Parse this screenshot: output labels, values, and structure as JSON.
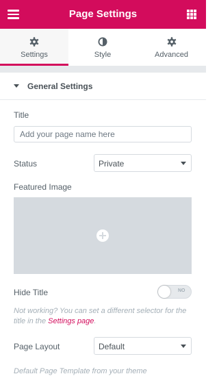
{
  "header": {
    "title": "Page Settings",
    "menu_icon": "hamburger-menu-icon",
    "apps_icon": "grid-apps-icon",
    "accent_color": "#d30c5c"
  },
  "tabs": [
    {
      "label": "Settings",
      "icon": "gear-icon",
      "active": true
    },
    {
      "label": "Style",
      "icon": "half-circle-contrast-icon",
      "active": false
    },
    {
      "label": "Advanced",
      "icon": "gear-icon",
      "active": false
    }
  ],
  "section": {
    "title": "General Settings",
    "icon": "caret-down-icon"
  },
  "fields": {
    "title_label": "Title",
    "title_placeholder": "Add your page name here",
    "title_value": "",
    "status_label": "Status",
    "status_value": "Private",
    "featured_image_label": "Featured Image",
    "featured_image_icon": "plus-circle-icon",
    "hide_title_label": "Hide Title",
    "hide_title_toggle_text": "NO",
    "hide_title_enabled": false,
    "hide_title_note_prefix": "Not working? You can set a different selector for the title in the ",
    "hide_title_note_link": "Settings page",
    "hide_title_note_suffix": ".",
    "page_layout_label": "Page Layout",
    "page_layout_value": "Default",
    "page_layout_note": "Default Page Template from your theme"
  }
}
